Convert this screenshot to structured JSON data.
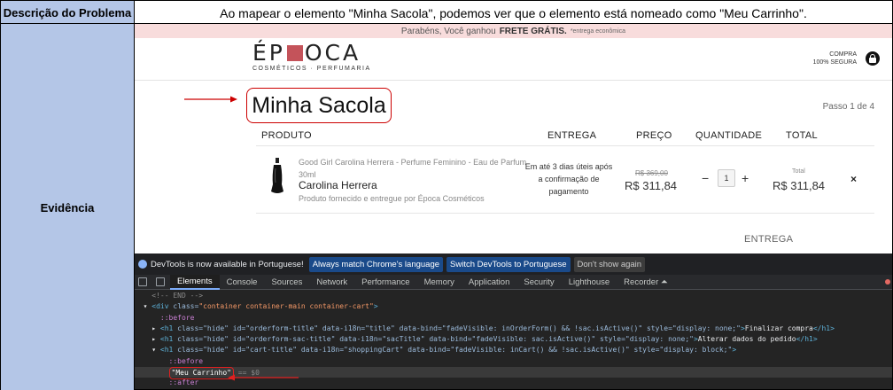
{
  "report": {
    "desc_label": "Descrição do Problema",
    "desc_text": "Ao mapear o elemento \"Minha Sacola\", podemos ver que o elemento está nomeado como \"Meu Carrinho\".",
    "evid_label": "Evidência"
  },
  "site": {
    "promo_prefix": "Parabéns, Você ganhou",
    "promo_bold": "FRETE GRÁTIS.",
    "promo_note": "*entrega econômica",
    "logo_left": "É",
    "logo_right": "OCA",
    "logo_p": "P",
    "logo_sub": "COSMÉTICOS · PERFUMARIA",
    "secure_line1": "COMPRA",
    "secure_line2": "100% SEGURA",
    "cart_title": "Minha Sacola",
    "step": "Passo 1 de 4",
    "columns": {
      "product": "PRODUTO",
      "delivery": "ENTREGA",
      "price": "PREÇO",
      "quantity": "QUANTIDADE",
      "total": "TOTAL"
    },
    "item": {
      "name": "Good Girl Carolina Herrera - Perfume Feminino - Eau de Parfum 30ml",
      "brand": "Carolina Herrera",
      "seller": "Produto fornecido e entregue por Época Cosméticos",
      "delivery": "Em até 3 dias úteis após a confirmação de pagamento",
      "old_price": "R$ 369,00",
      "price": "R$ 311,84",
      "qty_minus": "−",
      "qty": "1",
      "qty_plus": "+",
      "total_label": "Total",
      "total": "R$ 311,84",
      "remove": "×"
    },
    "entrega_heading": "ENTREGA"
  },
  "devtools": {
    "notice": "DevTools is now available in Portuguese!",
    "btn_match": "Always match Chrome's language",
    "btn_switch": "Switch DevTools to Portuguese",
    "btn_dont": "Don't show again",
    "tabs": [
      "Elements",
      "Console",
      "Sources",
      "Network",
      "Performance",
      "Memory",
      "Application",
      "Security",
      "Lighthouse",
      "Recorder ⏶"
    ],
    "code": {
      "l0": "<!-- END -->",
      "l1_tag": "div",
      "l1_attr": "class",
      "l1_val": "\"container container-main container-cart\"",
      "before": "::before",
      "h1a_text": "Finalizar compra",
      "h1b_text": "Alterar dados do pedido",
      "h1a_attrs": " class=\"hide\" id=\"orderform-title\" data-i18n=\"title\" data-bind=\"fadeVisible: inOrderForm() && !sac.isActive()\" style=\"display: none;\"",
      "h1b_attrs": " class=\"hide\" id=\"orderform-sac-title\" data-i18n=\"sacTitle\" data-bind=\"fadeVisible: sac.isActive()\" style=\"display: none;\"",
      "h1c_attrs": " class=\"hide\" id=\"cart-title\" data-i18n=\"shoppingCart\" data-bind=\"fadeVisible: inCart() && !sac.isActive()\" style=\"display: block;\"",
      "text_node": "\"Meu Carrinho\"",
      "eq": "== $0",
      "after": "::after"
    }
  },
  "colors": {
    "label_bg": "#b4c6e7",
    "highlight": "#e02020",
    "brand": "#c4535a"
  }
}
